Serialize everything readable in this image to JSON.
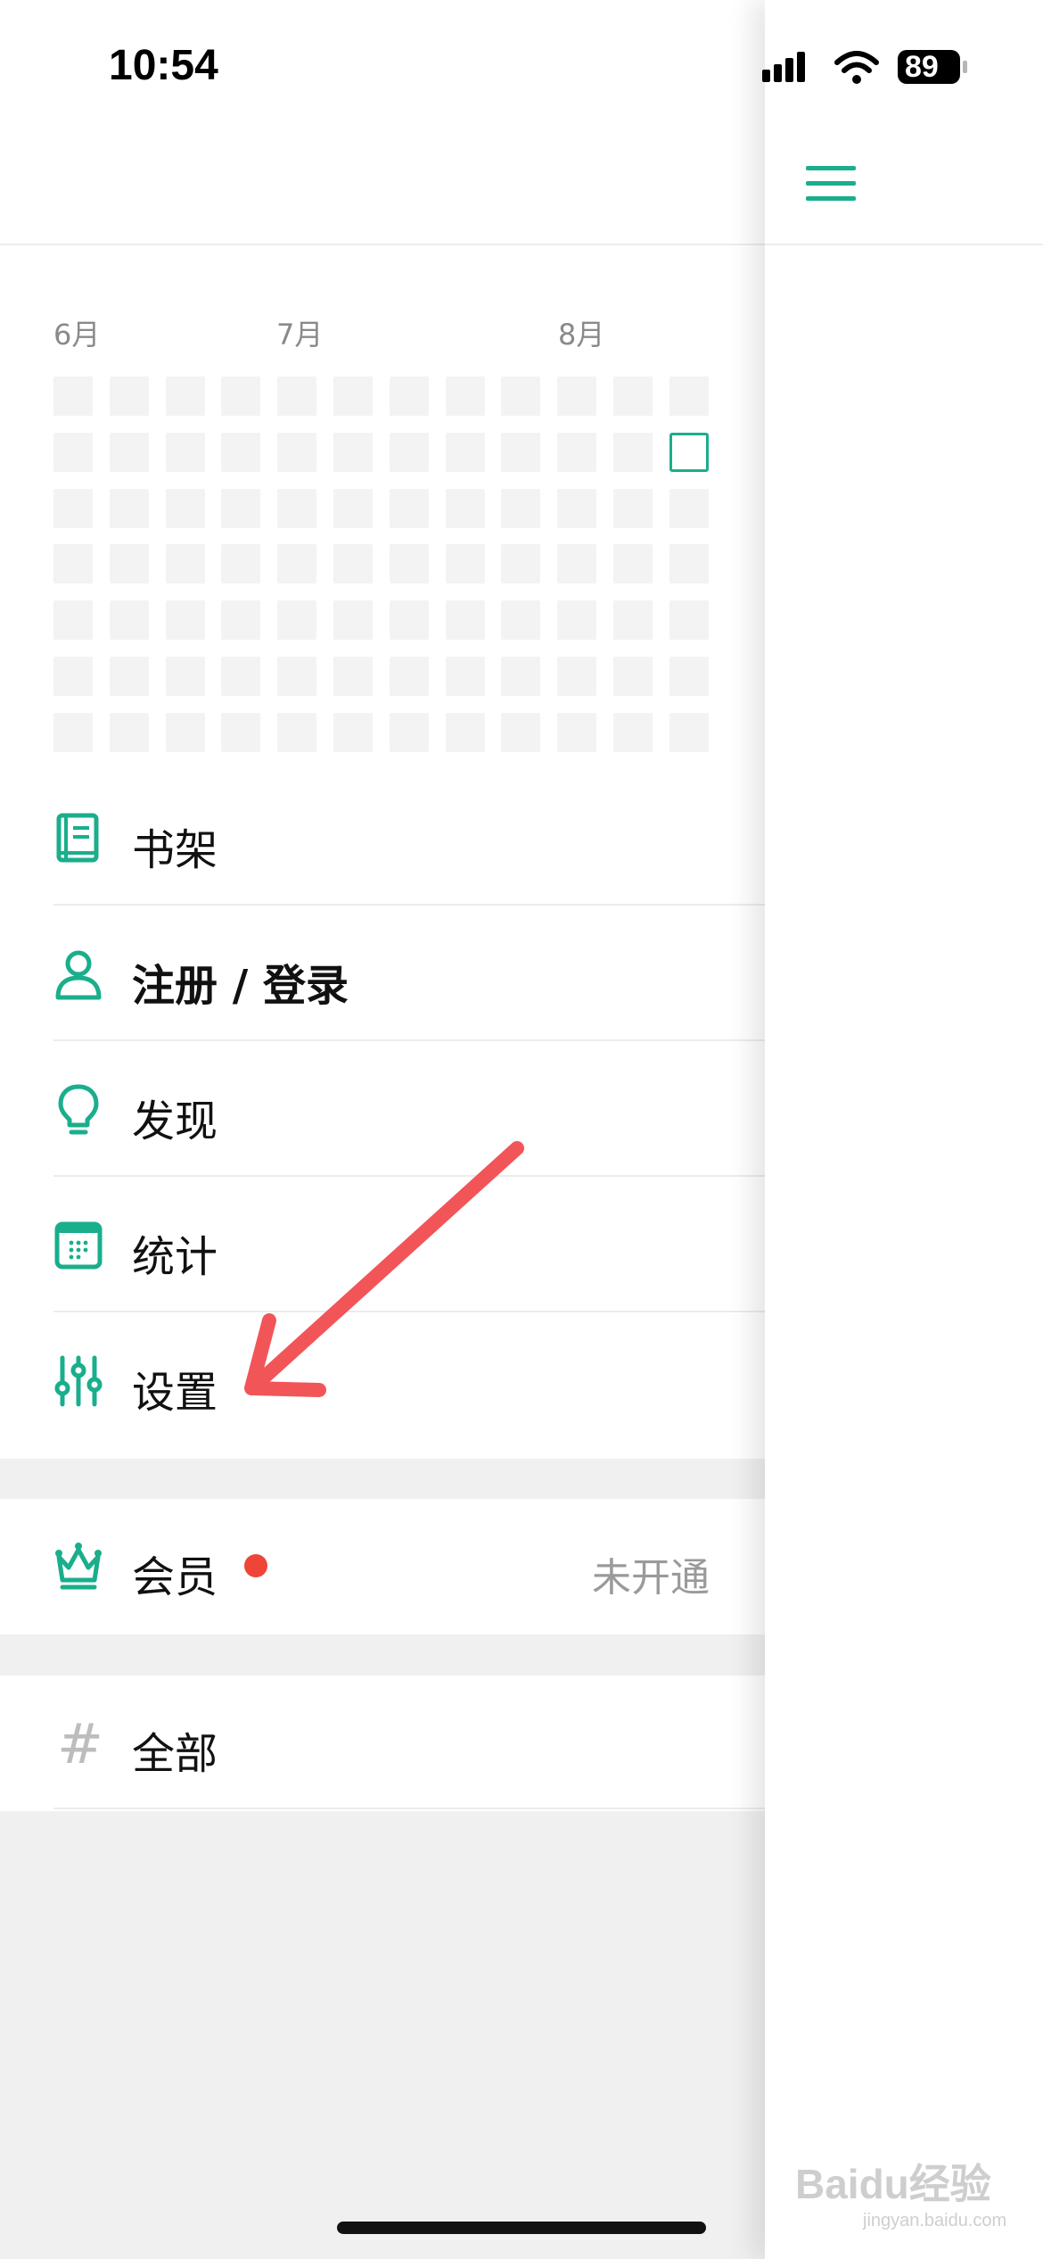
{
  "status_bar": {
    "time": "10:54",
    "battery": "89",
    "icons": [
      "signal-icon",
      "wifi-icon",
      "battery-icon"
    ]
  },
  "header": {
    "menu_icon": "hamburger-menu-icon"
  },
  "heatmap": {
    "months": [
      "6月",
      "7月",
      "8月"
    ],
    "rows": 7,
    "columns": 12,
    "highlighted_cell": {
      "row": 2,
      "column": 12
    },
    "accent_color": "#1aae8c",
    "empty_color": "#f3f3f3"
  },
  "menu": {
    "bookshelf": {
      "label": "书架",
      "icon": "book-icon"
    },
    "login": {
      "label": "注册 / 登录",
      "icon": "user-icon"
    },
    "discover": {
      "label": "发现",
      "icon": "lightbulb-icon"
    },
    "stats": {
      "label": "统计",
      "icon": "calendar-icon"
    },
    "settings": {
      "label": "设置",
      "icon": "sliders-icon"
    }
  },
  "membership": {
    "label": "会员",
    "icon": "crown-icon",
    "status": "未开通",
    "dot_color": "#ef4438"
  },
  "tags": {
    "all_label": "全部",
    "icon": "hash-icon"
  },
  "watermark": {
    "text": "Baidu经验",
    "sub": "jingyan.baidu.com"
  },
  "colors": {
    "accent": "#1aae8c",
    "annotation": "#f25558"
  }
}
